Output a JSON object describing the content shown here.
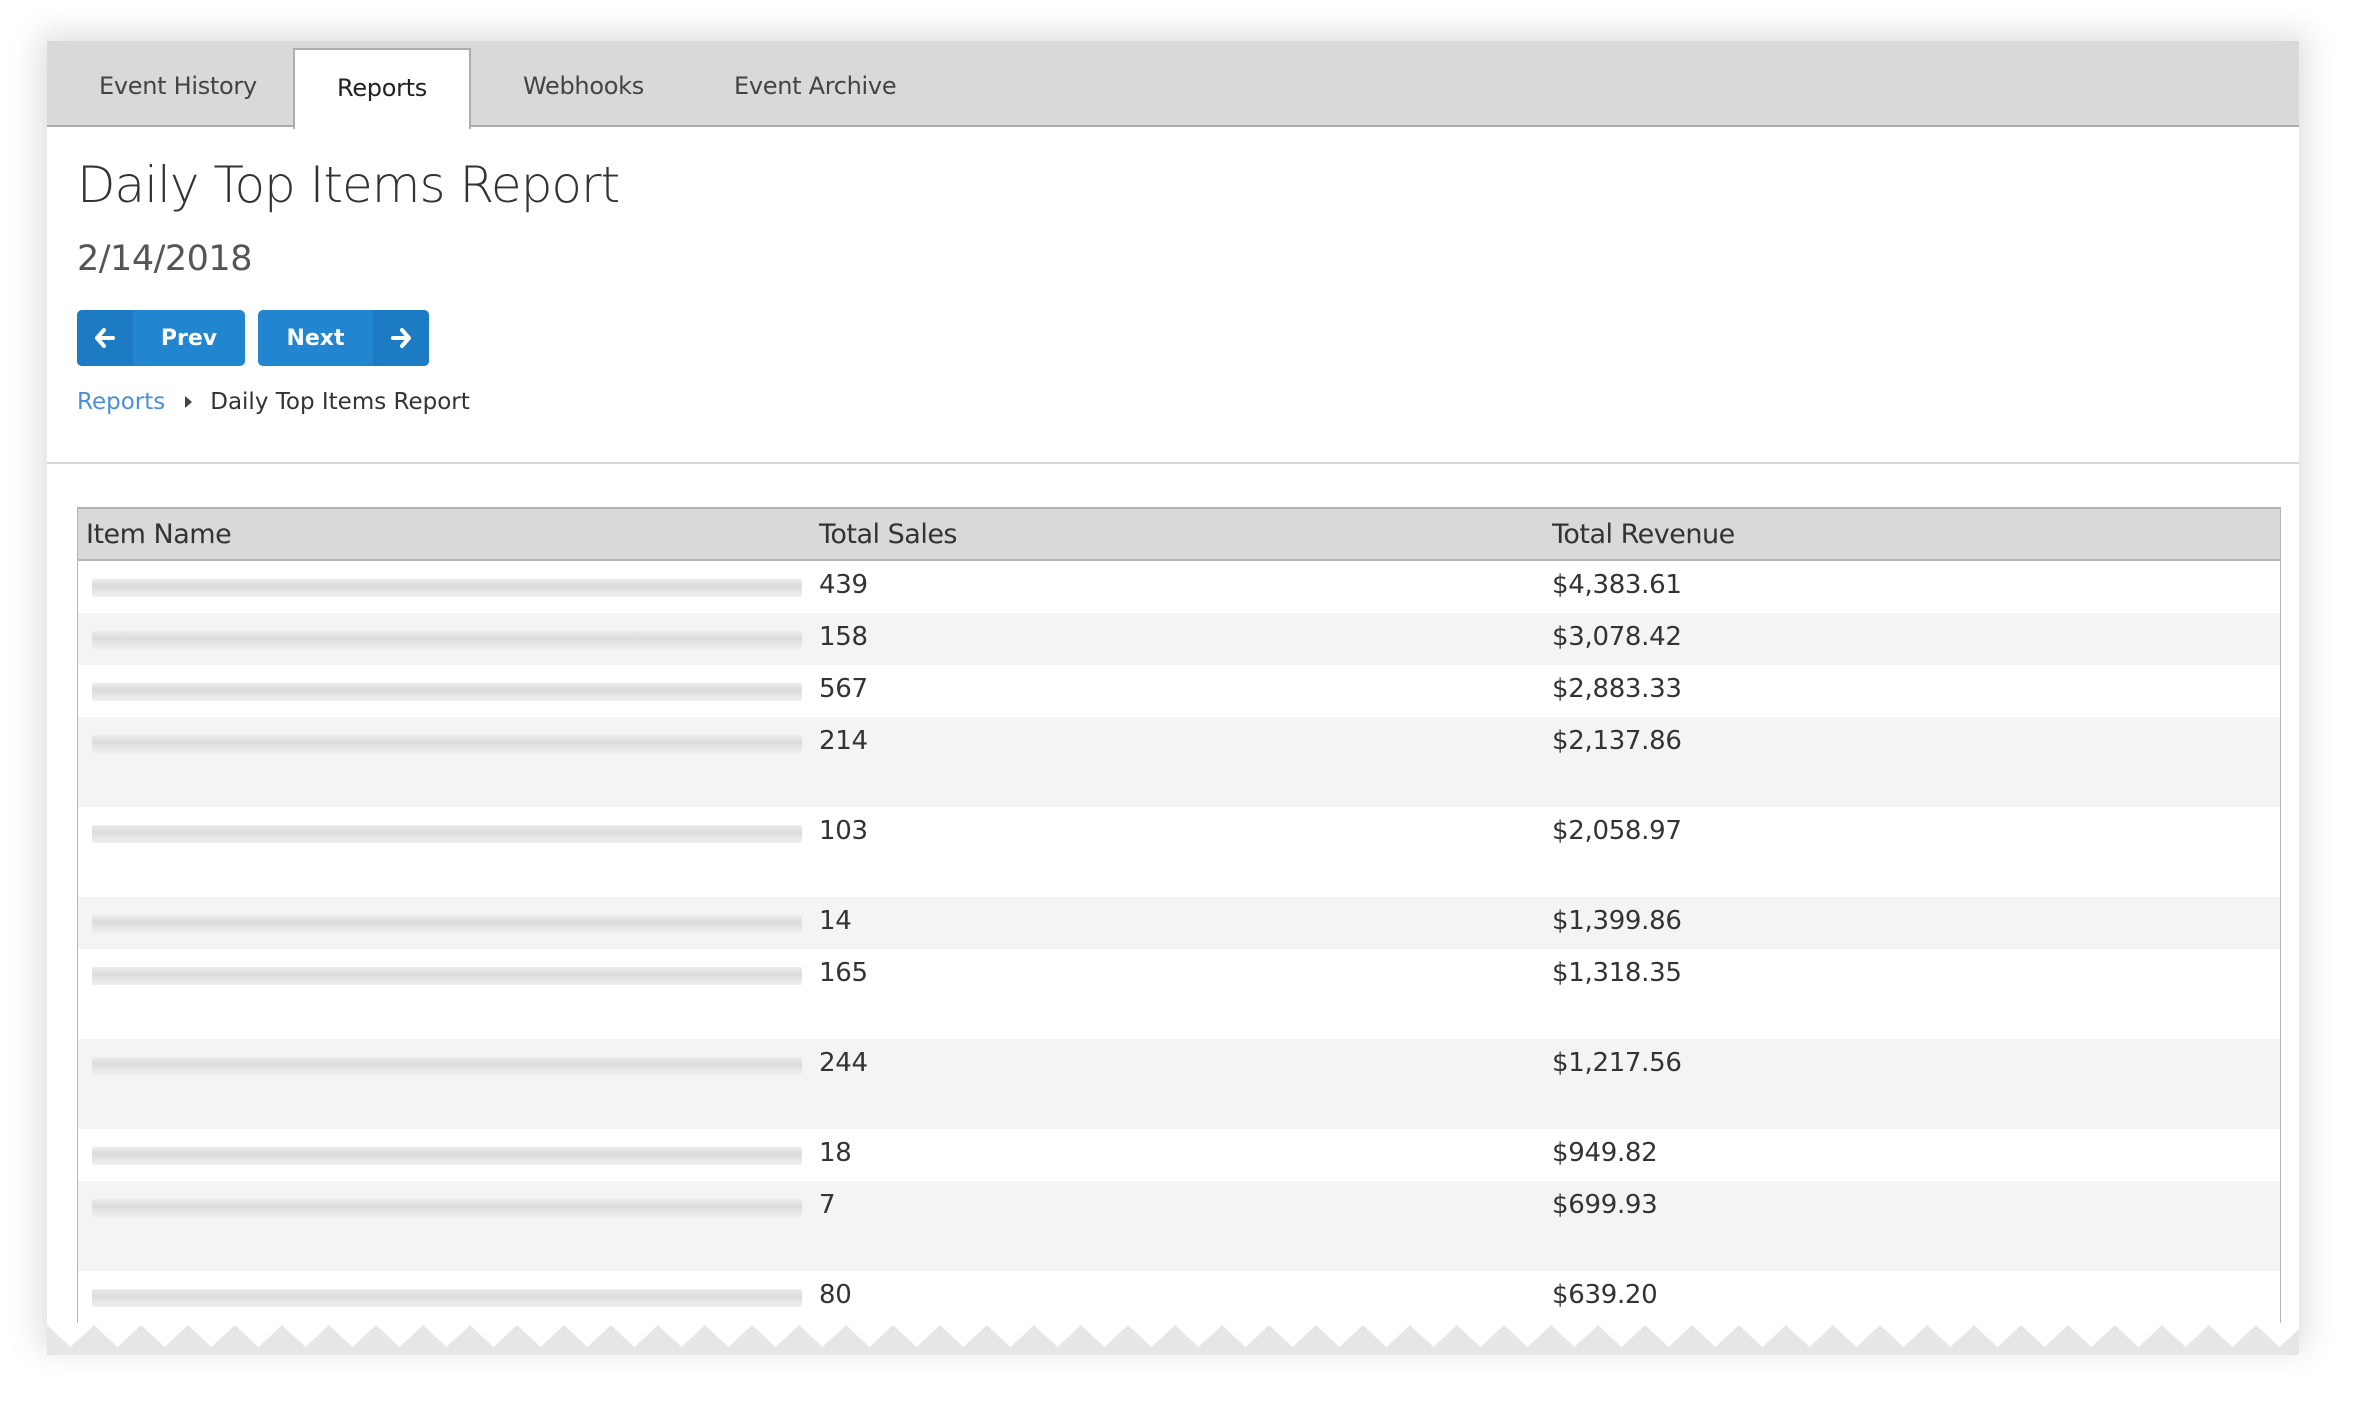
{
  "tabs": [
    {
      "label": "Event History",
      "active": false
    },
    {
      "label": "Reports",
      "active": true
    },
    {
      "label": "Webhooks",
      "active": false
    },
    {
      "label": "Event Archive",
      "active": false
    }
  ],
  "page": {
    "title": "Daily Top Items Report",
    "date": "2/14/2018"
  },
  "nav_buttons": {
    "prev_label": "Prev",
    "prev_icon": "arrow-left-icon",
    "next_label": "Next",
    "next_icon": "arrow-right-icon",
    "color": "#2185d0"
  },
  "breadcrumb": {
    "parent": "Reports",
    "separator_icon": "caret-right-icon",
    "current": "Daily Top Items Report"
  },
  "table": {
    "headers": [
      "Item Name",
      "Total Sales",
      "Total Revenue"
    ],
    "rows": [
      {
        "item_name": "[redacted]",
        "total_sales": "439",
        "total_revenue": "$4,383.61"
      },
      {
        "item_name": "[redacted]",
        "total_sales": "158",
        "total_revenue": "$3,078.42"
      },
      {
        "item_name": "[redacted]",
        "total_sales": "567",
        "total_revenue": "$2,883.33"
      },
      {
        "item_name": "[redacted]",
        "total_sales": "214",
        "total_revenue": "$2,137.86"
      },
      {
        "item_name": "[redacted]",
        "total_sales": "103",
        "total_revenue": "$2,058.97"
      },
      {
        "item_name": "[redacted]",
        "total_sales": "14",
        "total_revenue": "$1,399.86"
      },
      {
        "item_name": "[redacted]",
        "total_sales": "165",
        "total_revenue": "$1,318.35"
      },
      {
        "item_name": "[redacted]",
        "total_sales": "244",
        "total_revenue": "$1,217.56"
      },
      {
        "item_name": "[redacted]",
        "total_sales": "18",
        "total_revenue": "$949.82"
      },
      {
        "item_name": "[redacted]",
        "total_sales": "7",
        "total_revenue": "$699.93"
      },
      {
        "item_name": "[redacted]",
        "total_sales": "80",
        "total_revenue": "$639.20"
      }
    ]
  }
}
